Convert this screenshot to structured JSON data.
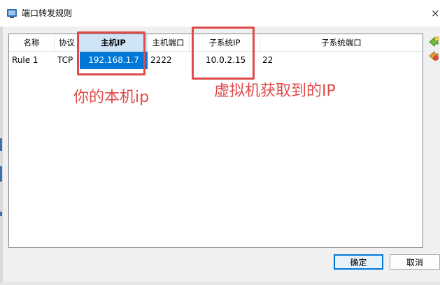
{
  "window": {
    "title": "端口转发规则",
    "close_glyph": "×"
  },
  "table": {
    "columns": [
      "名称",
      "协议",
      "主机IP",
      "主机端口",
      "子系统IP",
      "子系统端口"
    ],
    "selected_column": "主机IP",
    "rows": [
      {
        "name": "Rule 1",
        "protocol": "TCP",
        "host_ip": "192.168.1.7",
        "host_port": "2222",
        "guest_ip": "10.0.2.15",
        "guest_port": "22"
      }
    ]
  },
  "annotations": {
    "host_ip_note": "你的本机ip",
    "guest_ip_note": "虚拟机获取到的IP",
    "color": "#e04a4a"
  },
  "side_icons": [
    "add-rule-icon",
    "remove-rule-icon"
  ],
  "buttons": {
    "ok": "确定",
    "cancel": "取消"
  },
  "colors": {
    "selection": "#0078d7",
    "header_selected": "#cfe4f7"
  }
}
